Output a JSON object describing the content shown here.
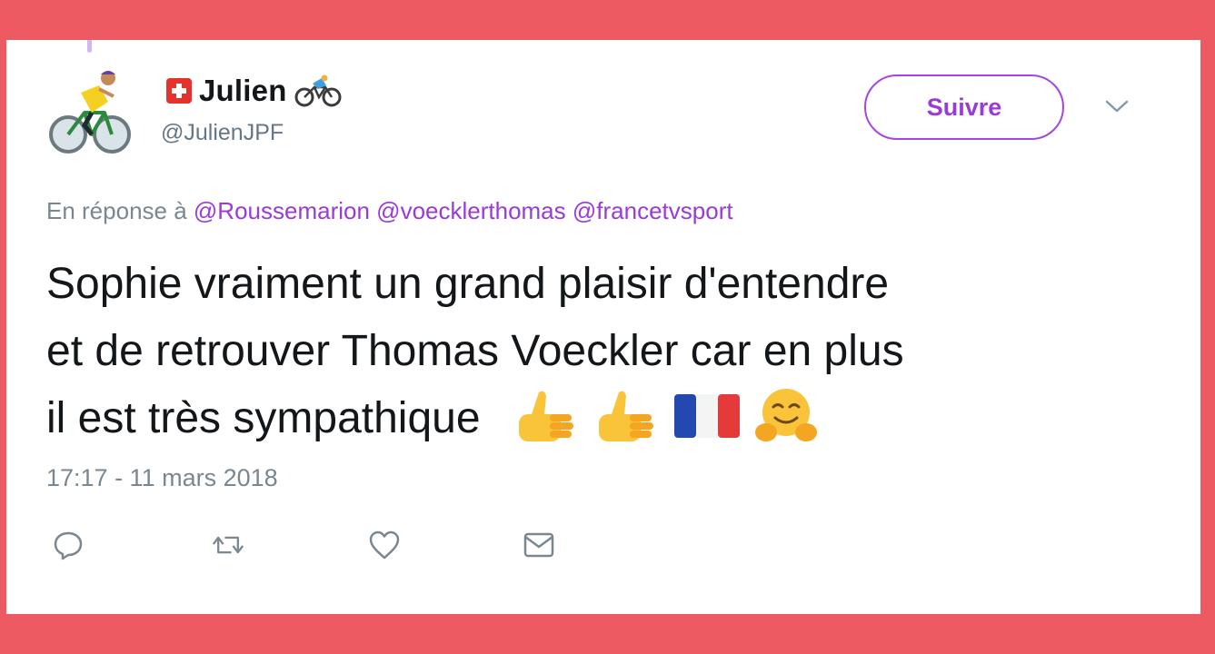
{
  "user": {
    "display_name": "Julien",
    "handle": "@JulienJPF"
  },
  "follow_button": {
    "label": "Suivre"
  },
  "reply": {
    "prefix": "En réponse à",
    "mentions": [
      "@Roussemarion",
      "@voecklerthomas",
      "@francetvsport"
    ]
  },
  "tweet": {
    "lines": [
      "Sophie vraiment un grand plaisir d'entendre",
      "et de retrouver Thomas Voeckler car en plus",
      "il est très sympathique"
    ],
    "emojis": [
      "thumbs-up-icon",
      "thumbs-up-icon",
      "france-flag-icon",
      "hugging-face-icon"
    ]
  },
  "timestamp": "17:17 - 11 mars 2018",
  "actions": [
    "reply-icon",
    "retweet-icon",
    "like-icon",
    "message-icon"
  ],
  "colors": {
    "background": "#ee5a62",
    "card": "#ffffff",
    "accent": "#9a3ad8",
    "muted": "#7a8791",
    "text": "#14171a"
  }
}
